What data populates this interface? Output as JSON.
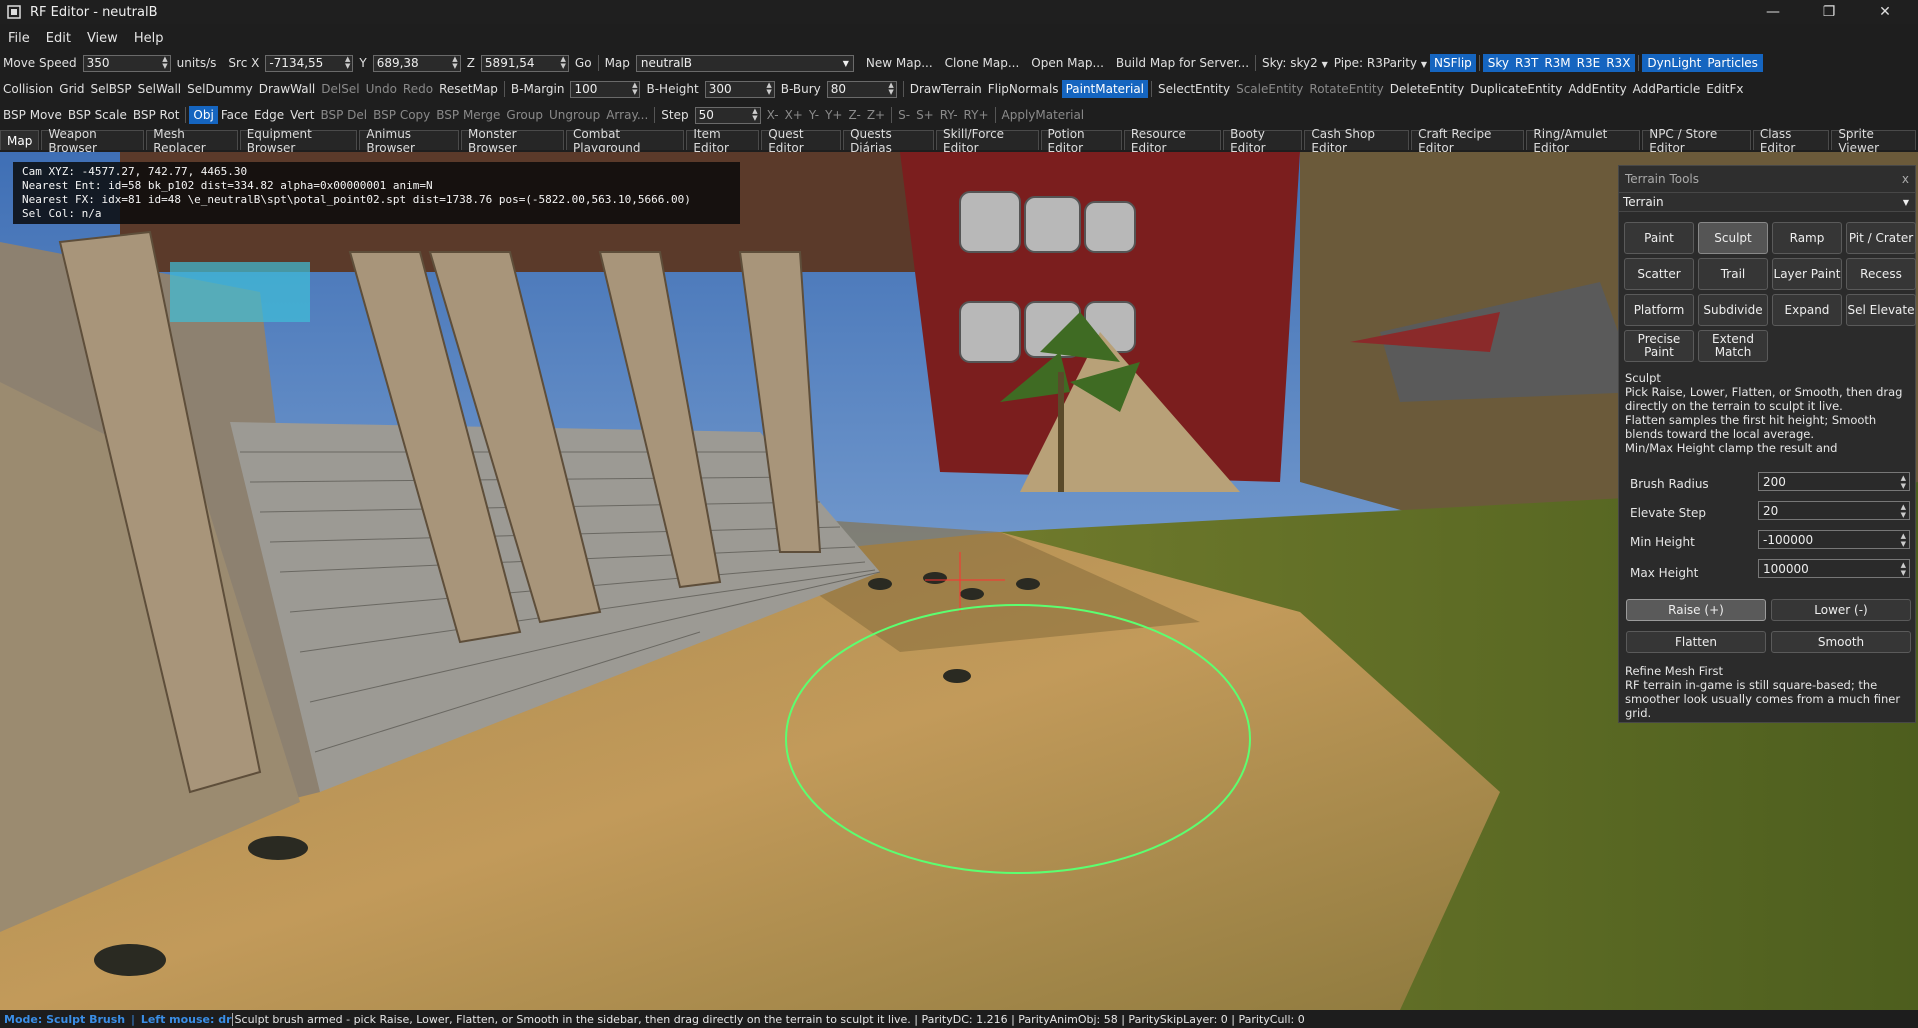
{
  "window": {
    "title": "RF Editor - neutralB",
    "minimize": "—",
    "maximize": "❐",
    "close": "✕"
  },
  "menu": [
    "File",
    "Edit",
    "View",
    "Help"
  ],
  "toolbar1": {
    "move_speed_label": "Move Speed",
    "move_speed": "350",
    "units": "units/s",
    "src_x_label": "Src X",
    "src_x": "-7134,55",
    "y_label": "Y",
    "y": "689,38",
    "z_label": "Z",
    "z": "5891,54",
    "go": "Go",
    "map_label": "Map",
    "map_value": "neutralB",
    "new_map": "New Map...",
    "clone_map": "Clone Map...",
    "open_map": "Open Map...",
    "build_map": "Build Map for Server...",
    "sky": "Sky: sky2",
    "pipe": "Pipe: R3Parity",
    "nsflip": "NSFlip",
    "sky_btn": "Sky",
    "r3t": "R3T",
    "r3m": "R3M",
    "r3e": "R3E",
    "r3x": "R3X",
    "dynlight": "DynLight",
    "particles": "Particles"
  },
  "toolbar2": {
    "collision": "Collision",
    "grid": "Grid",
    "selbsp": "SelBSP",
    "selwall": "SelWall",
    "seldummy": "SelDummy",
    "drawwall": "DrawWall",
    "delsel": "DelSel",
    "undo": "Undo",
    "redo": "Redo",
    "resetmap": "ResetMap",
    "bmargin_label": "B-Margin",
    "bmargin": "100",
    "bheight_label": "B-Height",
    "bheight": "300",
    "bbury_label": "B-Bury",
    "bbury": "80",
    "drawterrain": "DrawTerrain",
    "flipnormals": "FlipNormals",
    "paintmaterial": "PaintMaterial",
    "selectentity": "SelectEntity",
    "scaleentity": "ScaleEntity",
    "rotateentity": "RotateEntity",
    "deleteentity": "DeleteEntity",
    "duplicateentity": "DuplicateEntity",
    "addentity": "AddEntity",
    "addparticle": "AddParticle",
    "editfx": "EditFx"
  },
  "toolbar3": {
    "bspmove": "BSP Move",
    "bspscale": "BSP Scale",
    "bsprot": "BSP Rot",
    "obj": "Obj",
    "face": "Face",
    "edge": "Edge",
    "vert": "Vert",
    "bspdel": "BSP Del",
    "bspcopy": "BSP Copy",
    "bspmerge": "BSP Merge",
    "group": "Group",
    "ungroup": "Ungroup",
    "array": "Array...",
    "step_label": "Step",
    "step": "50",
    "xm": "X-",
    "xp": "X+",
    "ym": "Y-",
    "yp": "Y+",
    "zm": "Z-",
    "zp": "Z+",
    "sm": "S-",
    "sp": "S+",
    "rym": "RY-",
    "ryp": "RY+",
    "applymaterial": "ApplyMaterial"
  },
  "tabs": [
    "Map",
    "Weapon Browser",
    "Mesh Replacer",
    "Equipment Browser",
    "Animus Browser",
    "Monster Browser",
    "Combat Playground",
    "Item Editor",
    "Quest Editor",
    "Quests Diárias",
    "Skill/Force Editor",
    "Potion Editor",
    "Resource Editor",
    "Booty Editor",
    "Cash Shop Editor",
    "Craft Recipe Editor",
    "Ring/Amulet Editor",
    "NPC / Store Editor",
    "Class Editor",
    "Sprite Viewer"
  ],
  "hud": {
    "line1": "Cam XYZ: -4577.27, 742.77, 4465.30",
    "line2": "Nearest Ent: id=58 bk_p102 dist=334.82 alpha=0x00000001 anim=N",
    "line3": "Nearest FX: idx=81 id=48 \\e_neutralB\\spt\\potal_point02.spt dist=1738.76 pos=(-5822.00,563.10,5666.00)",
    "line4": "Sel Col: n/a"
  },
  "panel": {
    "title": "Terrain Tools",
    "close": "x",
    "category": "Terrain",
    "tools": [
      "Paint",
      "Sculpt",
      "Ramp",
      "Pit / Crater",
      "Scatter",
      "Trail",
      "Layer Paint",
      "Recess",
      "Platform",
      "Subdivide",
      "Expand",
      "Sel Elevate",
      "Precise Paint",
      "Extend Match"
    ],
    "section_title": "Sculpt",
    "desc1": "Pick Raise, Lower, Flatten, or Smooth, then drag directly on the terrain to sculpt it live.",
    "desc2": "Flatten samples the first hit height; Smooth blends toward the local average.",
    "desc3": "Min/Max Height clamp the result and",
    "brush_radius_label": "Brush Radius",
    "brush_radius": "200",
    "elevate_step_label": "Elevate Step",
    "elevate_step": "20",
    "min_height_label": "Min Height",
    "min_height": "-100000",
    "max_height_label": "Max Height",
    "max_height": "100000",
    "raise": "Raise (+)",
    "lower": "Lower (-)",
    "flatten": "Flatten",
    "smooth": "Smooth",
    "refine_title": "Refine Mesh First",
    "refine_desc": "RF terrain in-game is still square-based; the smoother look usually comes from a much finer grid."
  },
  "status": {
    "mode": "Mode: Sculpt Brush",
    "divider": "|",
    "left_mouse": "Left mouse: dr",
    "message": "Sculpt brush armed - pick Raise, Lower, Flatten, or Smooth in the sidebar, then drag directly on the terrain to sculpt it live. | ParityDC: 1.216 | ParityAnimObj: 58 | ParitySkipLayer: 0 | ParityCull: 0"
  },
  "colors": {
    "accent": "#1565c0",
    "status_blue": "#3a8ee6",
    "brush_ring": "#5cff70"
  }
}
